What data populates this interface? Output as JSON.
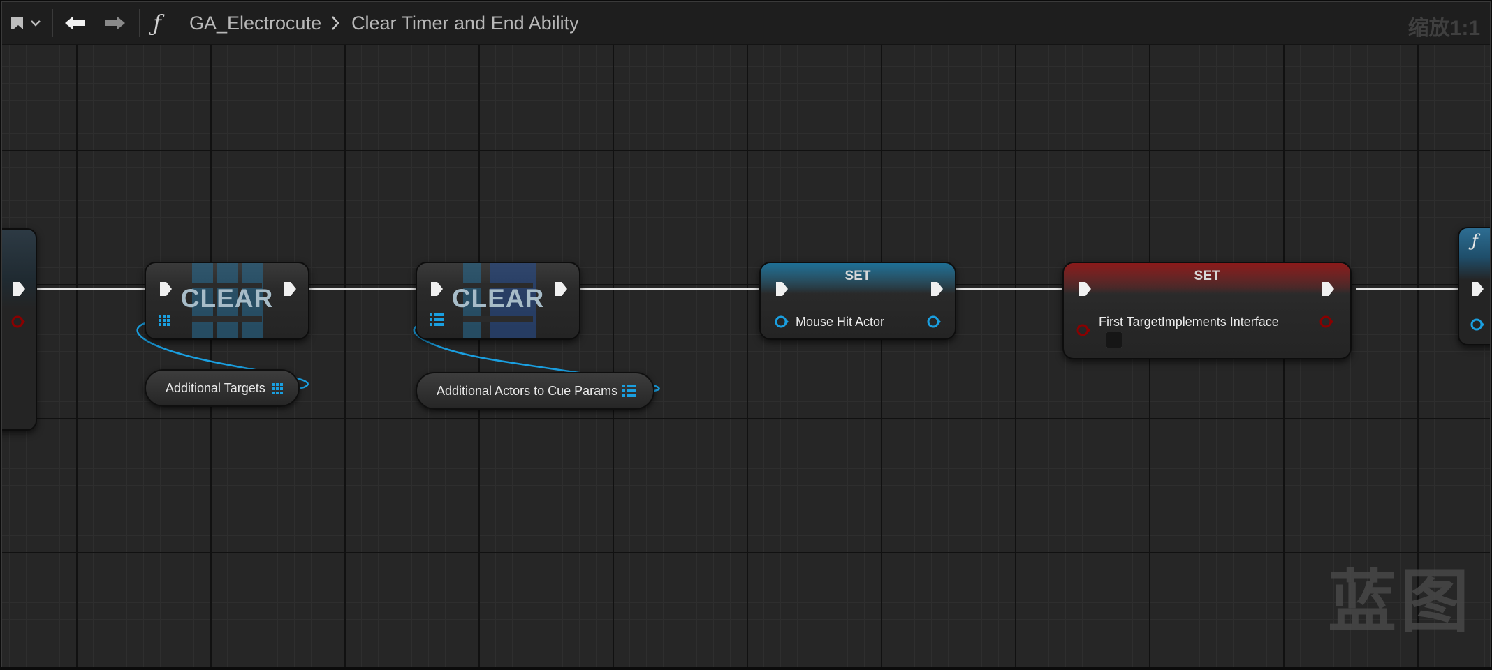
{
  "toolbar": {
    "breadcrumb_root": "GA_Electrocute",
    "breadcrumb_current": "Clear Timer and End Ability",
    "function_symbol": "ƒ",
    "zoom": "缩放1:1",
    "bookmark_icon": "bookmark-icon",
    "back_icon": "arrow-left-icon",
    "forward_icon": "arrow-right-icon"
  },
  "watermark": "蓝图",
  "nodes": {
    "clear1": {
      "title": "CLEAR"
    },
    "clear2": {
      "title": "CLEAR"
    },
    "set1": {
      "title": "SET",
      "pin_label": "Mouse Hit Actor"
    },
    "set2": {
      "title": "SET",
      "pin_label": "First TargetImplements Interface"
    },
    "getter1": {
      "label": "Additional Targets"
    },
    "getter2": {
      "label": "Additional Actors to Cue Params"
    },
    "partial_fn": {
      "symbol": "ƒ"
    }
  },
  "colors": {
    "exec": "#e6e6e6",
    "object_pin": "#1a9fe0",
    "bool_pin": "#8a0000",
    "set1_header": "#1e6f95",
    "set2_header": "#8a1a1a"
  }
}
